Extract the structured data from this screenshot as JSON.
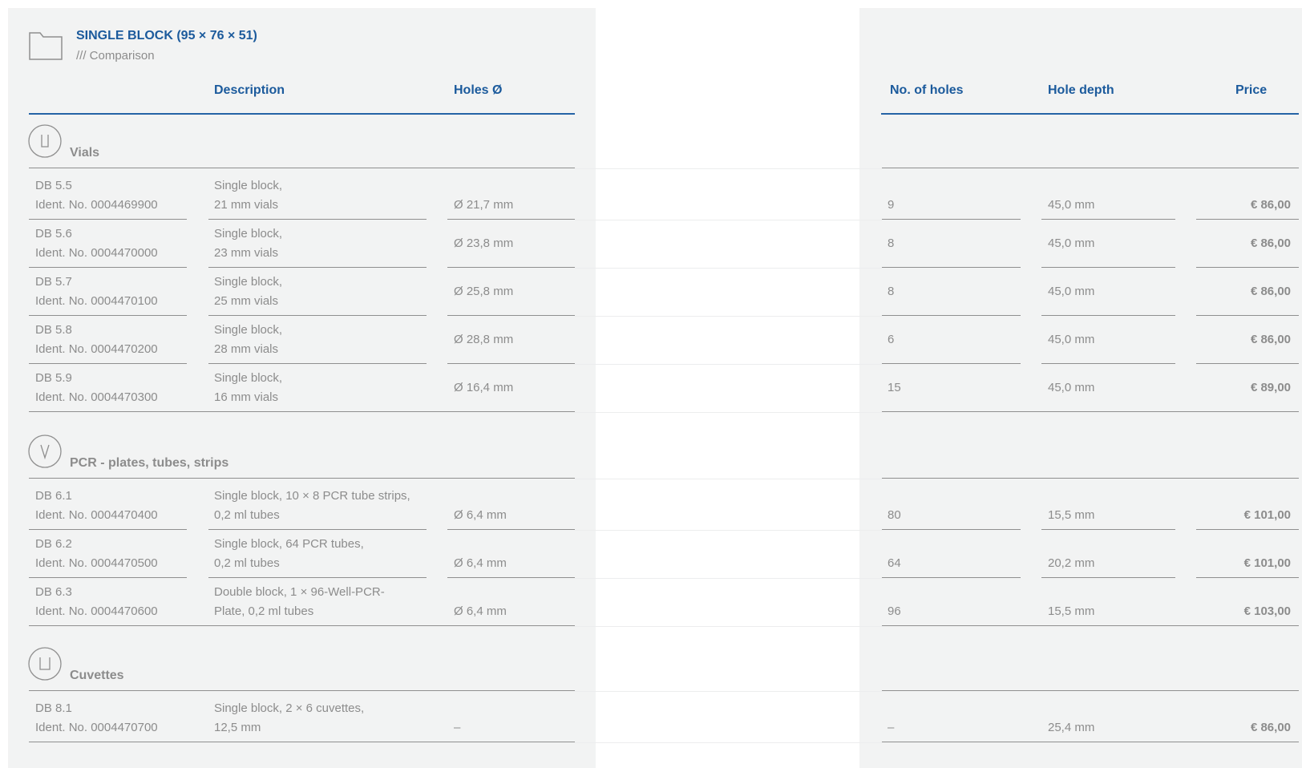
{
  "page": {
    "title": "SINGLE BLOCK (95 × 76 × 51)",
    "subtitle": "/// Comparison",
    "folder_icon": "folder-icon"
  },
  "columns": {
    "description": "Description",
    "holes_diameter": "Holes Ø",
    "no_of_holes": "No. of holes",
    "hole_depth": "Hole depth",
    "price": "Price"
  },
  "colors": {
    "accent": "#1b5a9c",
    "panel": "#f2f3f3",
    "text": "#8c8c8c"
  },
  "sections": [
    {
      "label": "Vials",
      "icon": "vial-icon",
      "rows": [
        {
          "code": "DB 5.5",
          "ident": "Ident. No. 0004469900",
          "desc1": "Single block,",
          "desc2": "21 mm vials",
          "diameter": "Ø 21,7 mm",
          "holes": "9",
          "depth": "45,0 mm",
          "price": "€ 86,00"
        },
        {
          "code": "DB 5.6",
          "ident": "Ident. No. 0004470000",
          "desc1": "Single block,",
          "desc2": "23 mm vials",
          "diameter": "Ø 23,8 mm",
          "holes": "8",
          "depth": "45,0 mm",
          "price": "€ 86,00"
        },
        {
          "code": "DB 5.7",
          "ident": "Ident. No. 0004470100",
          "desc1": "Single block,",
          "desc2": "25 mm vials",
          "diameter": "Ø 25,8 mm",
          "holes": "8",
          "depth": "45,0 mm",
          "price": "€ 86,00"
        },
        {
          "code": "DB 5.8",
          "ident": "Ident. No. 0004470200",
          "desc1": "Single block,",
          "desc2": "28 mm vials",
          "diameter": "Ø 28,8 mm",
          "holes": "6",
          "depth": "45,0 mm",
          "price": "€ 86,00"
        },
        {
          "code": "DB 5.9",
          "ident": "Ident. No. 0004470300",
          "desc1": "Single block,",
          "desc2": "16 mm vials",
          "diameter": "Ø 16,4 mm",
          "holes": "15",
          "depth": "45,0 mm",
          "price": "€ 89,00"
        }
      ]
    },
    {
      "label": "PCR - plates, tubes, strips",
      "icon": "pcr-tube-icon",
      "rows": [
        {
          "code": "DB 6.1",
          "ident": "Ident. No. 0004470400",
          "desc1": "Single block, 10 × 8 PCR tube strips,",
          "desc2": "0,2 ml tubes",
          "diameter": "Ø 6,4 mm",
          "holes": "80",
          "depth": "15,5 mm",
          "price": "€ 101,00"
        },
        {
          "code": "DB 6.2",
          "ident": "Ident. No. 0004470500",
          "desc1": "Single block, 64 PCR tubes,",
          "desc2": "0,2 ml tubes",
          "diameter": "Ø 6,4 mm",
          "holes": "64",
          "depth": "20,2 mm",
          "price": "€ 101,00"
        },
        {
          "code": "DB 6.3",
          "ident": "Ident. No. 0004470600",
          "desc1": "Double block, 1 × 96-Well-PCR-",
          "desc2": "Plate, 0,2 ml tubes",
          "diameter": "Ø 6,4 mm",
          "holes": "96",
          "depth": "15,5 mm",
          "price": "€ 103,00"
        }
      ]
    },
    {
      "label": "Cuvettes",
      "icon": "cuvette-icon",
      "rows": [
        {
          "code": "DB 8.1",
          "ident": "Ident. No. 0004470700",
          "desc1": "Single block, 2 × 6 cuvettes,",
          "desc2": "12,5 mm",
          "diameter": "–",
          "holes": "–",
          "depth": "25,4 mm",
          "price": "€ 86,00"
        }
      ]
    }
  ]
}
